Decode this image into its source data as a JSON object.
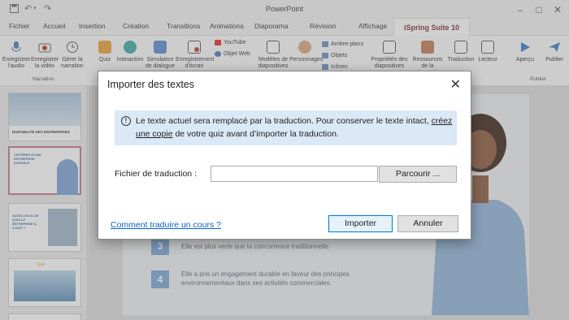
{
  "app": {
    "title": "PowerPoint"
  },
  "tabs": [
    "Fichier",
    "Accueil",
    "Insertion",
    "Création",
    "Transitions",
    "Animations",
    "Diaporama",
    "Révision",
    "Affichage",
    "iSpring Suite 10"
  ],
  "ribbon": {
    "narration": [
      {
        "label": "Enregistrer l'audio"
      },
      {
        "label": "Enregistrer la vidéo"
      },
      {
        "label": "Gérer la narration"
      }
    ],
    "narration_group": "Narration",
    "insert": [
      {
        "label": "Quiz"
      },
      {
        "label": "Interaction"
      },
      {
        "label": "Simulation de dialogue"
      },
      {
        "label": "Enregistrement d'écran"
      }
    ],
    "web": [
      {
        "label": "YouTube"
      },
      {
        "label": "Objet Web"
      }
    ],
    "content": [
      {
        "label": "Modèles de diapositives"
      },
      {
        "label": "Personnages"
      }
    ],
    "content_small": [
      {
        "label": "Arrière-plans"
      },
      {
        "label": "Objets"
      },
      {
        "label": "Icônes"
      }
    ],
    "publish": [
      {
        "label": "Propriétés des diapositives"
      },
      {
        "label": "Ressources de la présentation"
      },
      {
        "label": "Traduction"
      },
      {
        "label": "Lecteur"
      },
      {
        "label": "Aperçu"
      },
      {
        "label": "Publier"
      }
    ],
    "publish_group": "Publier"
  },
  "thumbnails": [
    {
      "caption": "DURABILITÉ DES ENTREPRISES"
    },
    {
      "caption": "CRITÈRES D'UNE ENTREPRISE DURABLE"
    },
    {
      "caption": "SAVEZ-VOUS DE QUELLE ENTREPRISE IL S'AGIT ?"
    },
    {
      "caption": "Quiz"
    }
  ],
  "slide": {
    "rows": [
      {
        "num": "3",
        "text": "Elle est plus verte que la concurrence traditionnelle."
      },
      {
        "num": "4",
        "text": "Elle a pris un engagement durable en faveur des principes environnementaux dans ses activités commerciales."
      }
    ]
  },
  "dialog": {
    "title": "Importer des textes",
    "info_part1": "Le texte actuel sera remplacé par la traduction. Pour conserver le texte intact, ",
    "info_link": "créez une copie",
    "info_part2": " de votre quiz avant d’importer la traduction.",
    "file_label": "Fichier de traduction :",
    "file_value": "",
    "browse_label": "Parcourir ...",
    "help_link": "Comment traduire un cours ?",
    "import_label": "Importer",
    "cancel_label": "Annuler"
  },
  "colors": {
    "accent": "#7a2a3a",
    "info_bg": "#dbe8f6",
    "link": "#0e63c8",
    "row_num": "#7ba7d7"
  }
}
